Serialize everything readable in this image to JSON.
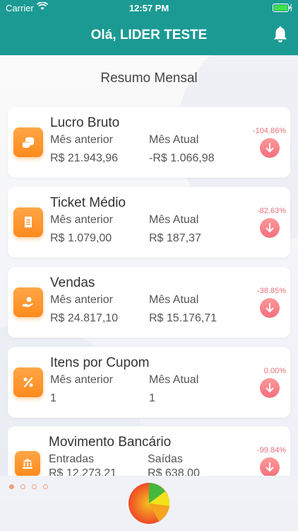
{
  "status_bar": {
    "carrier": "Carrier",
    "time": "12:57 PM"
  },
  "header": {
    "title": "Olá, LIDER TESTE",
    "bell_icon": "bell-icon"
  },
  "section": {
    "title": "Resumo Mensal"
  },
  "cards": [
    {
      "title": "Lucro Bruto",
      "label_prev": "Mês anterior",
      "label_curr": "Mês Atual",
      "value_prev": "R$ 21.943,96",
      "value_curr": "-R$ 1.066,98",
      "change": "-104.86%",
      "icon": "coins-icon",
      "trend_icon": "arrow-down-icon"
    },
    {
      "title": "Ticket Médio",
      "label_prev": "Mês anterior",
      "label_curr": "Mês Atual",
      "value_prev": "R$ 1.079,00",
      "value_curr": "R$ 187,37",
      "change": "-82.63%",
      "icon": "receipt-icon",
      "trend_icon": "arrow-down-icon"
    },
    {
      "title": "Vendas",
      "label_prev": "Mês anterior",
      "label_curr": "Mês Atual",
      "value_prev": "R$ 24.817,10",
      "value_curr": "R$ 15.176,71",
      "change": "-38.85%",
      "icon": "hand-coin-icon",
      "trend_icon": "arrow-down-icon"
    },
    {
      "title": "Itens por Cupom",
      "label_prev": "Mês anterior",
      "label_curr": "Mês Atual",
      "value_prev": "1",
      "value_curr": "1",
      "change": "0.00%",
      "icon": "percent-icon",
      "trend_icon": "arrow-down-icon"
    },
    {
      "title": "Movimento Bancário",
      "label_prev": "Entradas",
      "label_curr": "Saídas",
      "value_prev": "R$ 12.273,21",
      "value_curr": "R$ 638,00",
      "change": "-99.84%",
      "icon": "bank-icon",
      "trend_icon": "arrow-down-icon"
    }
  ],
  "pagination": {
    "count": 4,
    "active_index": 0
  },
  "colors": {
    "teal": "#1b9a93",
    "orange": "#ff9330",
    "down_red": "#f46f7c",
    "pie_green": "#46b83c",
    "pie_yellow": "#f2e21b",
    "pie_red": "#f04a28",
    "pie_orange": "#f5a41e"
  }
}
